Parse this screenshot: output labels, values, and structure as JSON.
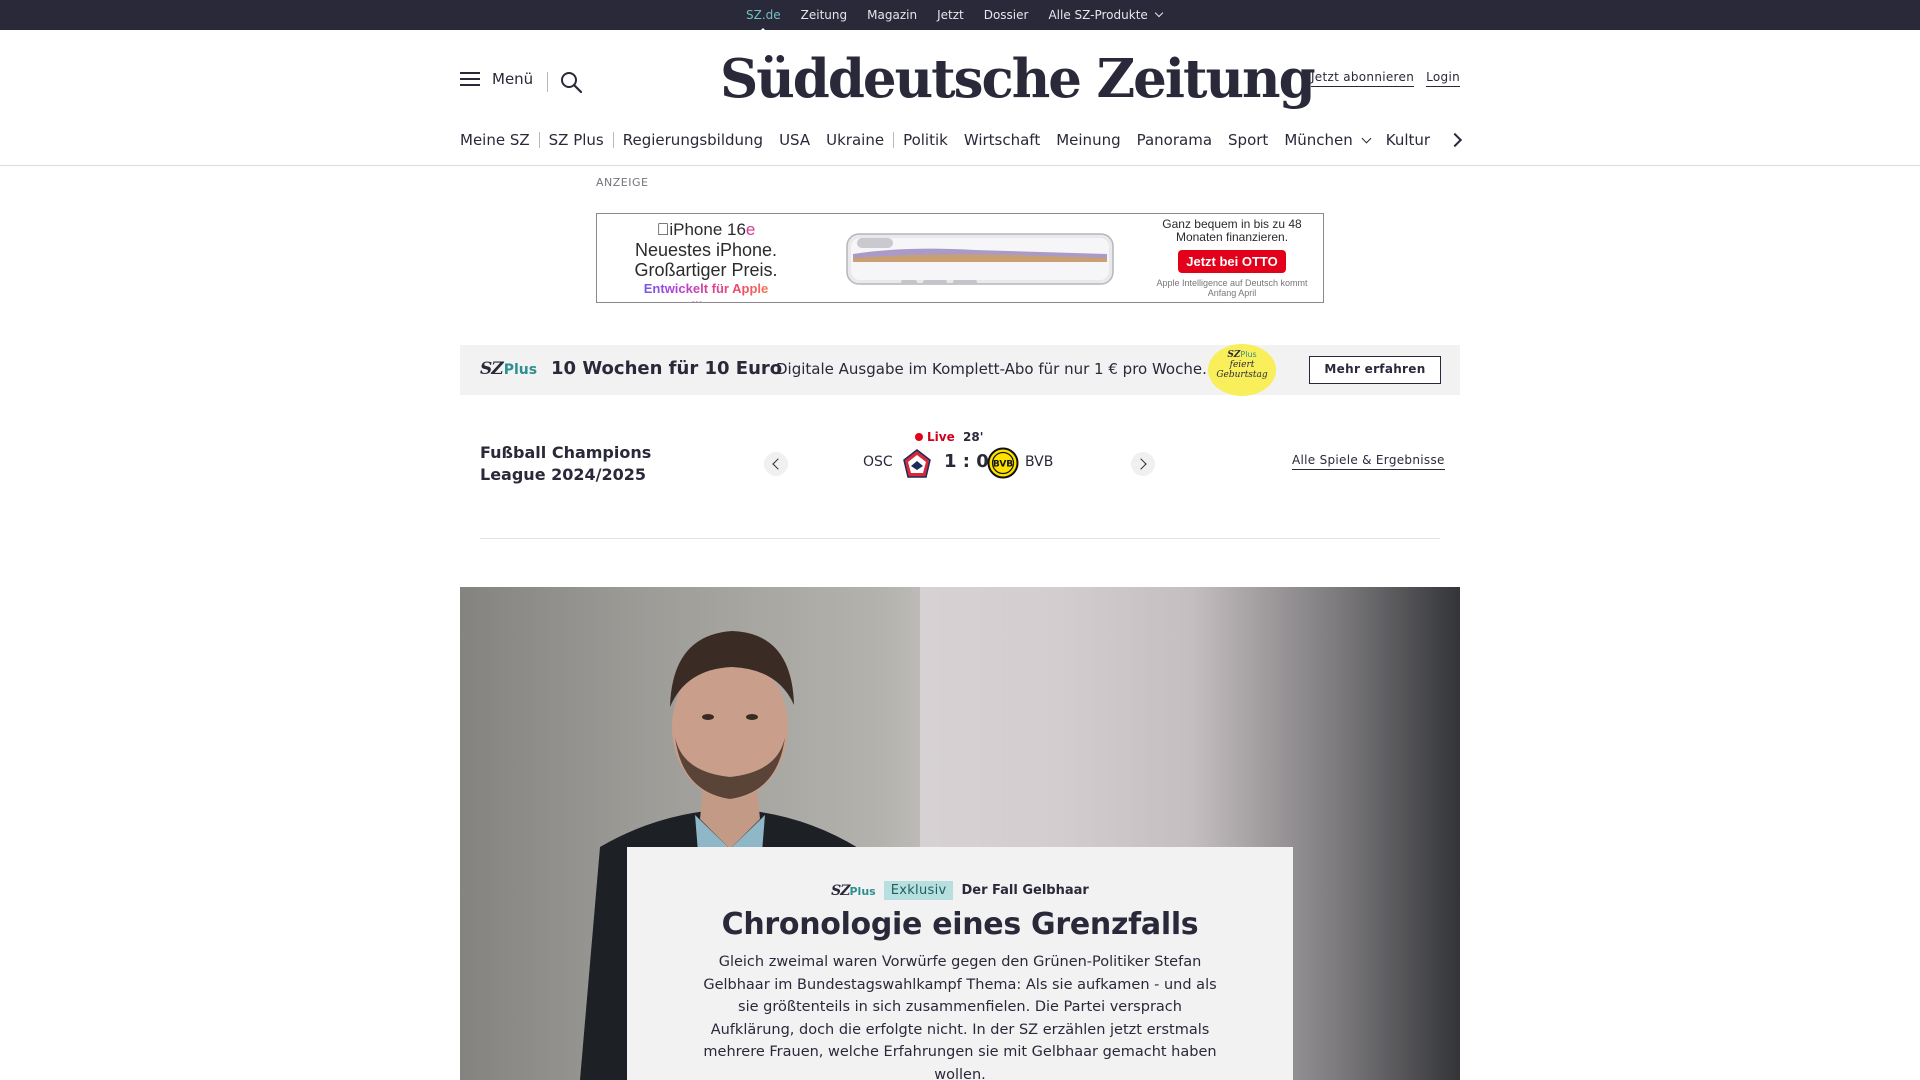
{
  "topbar": {
    "items": [
      "SZ.de",
      "Zeitung",
      "Magazin",
      "Jetzt",
      "Dossier",
      "Alle SZ-Produkte"
    ]
  },
  "header": {
    "menu_label": "Menü",
    "logo_text": "Süddeutsche Zeitung",
    "subscribe": "Jetzt abonnieren",
    "login": "Login"
  },
  "category_nav": {
    "items": [
      "Meine SZ",
      "SZ Plus",
      "Regierungsbildung",
      "USA",
      "Ukraine",
      "Politik",
      "Wirtschaft",
      "Meinung",
      "Panorama",
      "Sport",
      "München",
      "Kultur"
    ]
  },
  "ad": {
    "label": "ANZEIGE",
    "model": "iPhone 16",
    "model_suffix": "e",
    "headline_1": "Neuestes iPhone.",
    "headline_2": "Großartiger Preis.",
    "tagline": "Entwickelt für Apple Intelligence.",
    "finance_text": "Ganz bequem in bis zu 48 Monaten finanzieren.",
    "button": "Jetzt bei OTTO",
    "note": "Apple Intelligence auf Deutsch kommt Anfang April"
  },
  "promo": {
    "brand_sz": "SZ",
    "brand_plus": "Plus",
    "title": "10 Wochen für 10 Euro",
    "text": "Digitale Ausgabe im Komplett-Abo für nur 1 € pro Woche.",
    "badge_sz": "SZ",
    "badge_plus": "Plus",
    "badge_line1": "feiert",
    "badge_line2": "Geburtstag",
    "button": "Mehr erfahren"
  },
  "scoreboard": {
    "league": "Fußball Champions League 2024/2025",
    "status": "Live",
    "minute": "28'",
    "home_team": "OSC",
    "away_team": "BVB",
    "score": "1 : 0",
    "all_games_link": "Alle Spiele & Ergebnisse"
  },
  "teaser": {
    "brand_sz": "SZ",
    "brand_plus": "Plus",
    "badge": "Exklusiv",
    "kicker": "Der Fall Gelbhaar",
    "headline": "Chronologie eines Grenzfalls",
    "summary": "Gleich zweimal waren Vorwürfe gegen den Grünen-Politiker Stefan Gelbhaar im Bundestagswahlkampf Thema: Als sie aufkamen - und als sie größtenteils in sich zusammenfielen. Die Partei versprach Aufklärung, doch die erfolgte nicht. In der SZ erzählen jetzt erstmals mehrere Frauen, welche Erfahrungen sie mit Gelbhaar gemacht haben wollen."
  },
  "colors": {
    "brand_dark": "#29293a",
    "plus_teal": "#2e8f8f",
    "live_red": "#e2001a",
    "promo_bg": "#f2f2f3",
    "badge_yellow": "#f9ef5b"
  }
}
